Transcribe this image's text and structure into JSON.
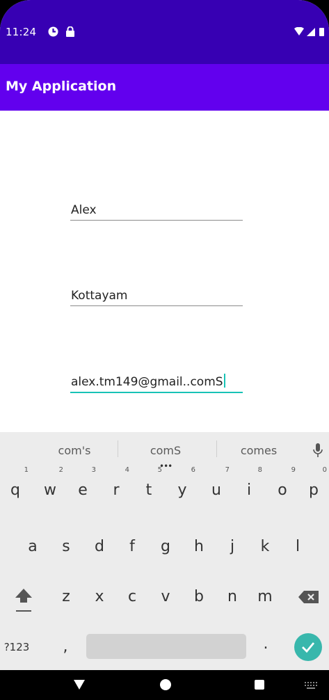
{
  "status_bar": {
    "time": "11:24",
    "icons_left": [
      "pocket-sync-icon",
      "lock-icon"
    ],
    "icons_right": [
      "wifi-icon",
      "signal-icon",
      "battery-icon"
    ]
  },
  "app_bar": {
    "title": "My Application"
  },
  "form": {
    "name_value": "Alex",
    "place_value": "Kottayam",
    "email_value": "alex.tm149@gmail..comS"
  },
  "keyboard": {
    "suggestions": [
      "com's",
      "comS",
      "comes"
    ],
    "row1": [
      {
        "key": "q",
        "hint": "1"
      },
      {
        "key": "w",
        "hint": "2"
      },
      {
        "key": "e",
        "hint": "3"
      },
      {
        "key": "r",
        "hint": "4"
      },
      {
        "key": "t",
        "hint": "5"
      },
      {
        "key": "y",
        "hint": "6"
      },
      {
        "key": "u",
        "hint": "7"
      },
      {
        "key": "i",
        "hint": "8"
      },
      {
        "key": "o",
        "hint": "9"
      },
      {
        "key": "p",
        "hint": "0"
      }
    ],
    "row2": [
      "a",
      "s",
      "d",
      "f",
      "g",
      "h",
      "j",
      "k",
      "l"
    ],
    "row3": [
      "z",
      "x",
      "c",
      "v",
      "b",
      "n",
      "m"
    ],
    "symbols_key": "?123",
    "comma_key": ",",
    "period_key": ".",
    "colors": {
      "enter": "#38b7ac",
      "cursor": "#18c3b6"
    }
  },
  "colors": {
    "status_bar": "#3700B3",
    "app_bar": "#6200EE"
  }
}
